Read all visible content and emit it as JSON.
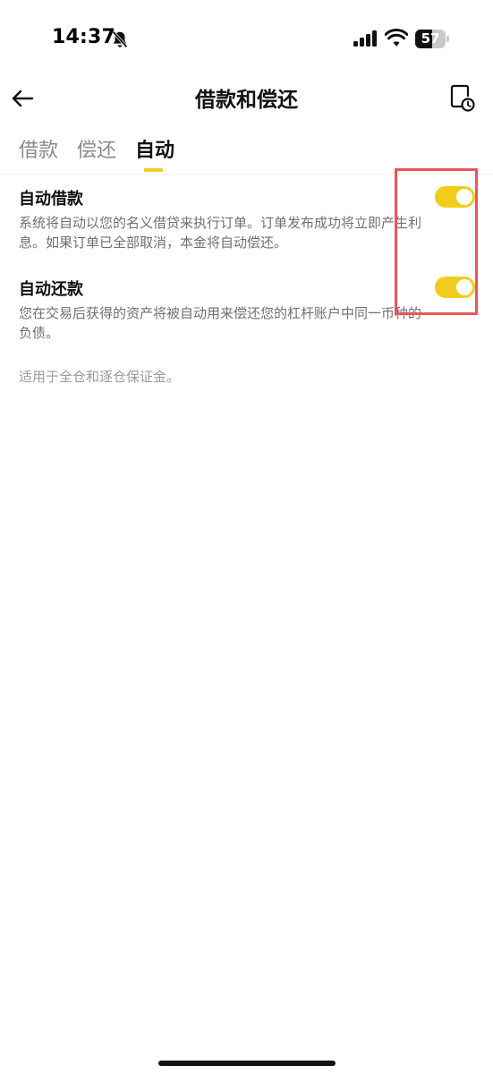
{
  "status_bar": {
    "time": "14:37",
    "battery_level": "57",
    "battery_fraction": 0.57
  },
  "header": {
    "title": "借款和偿还",
    "back_icon": "arrow-left-icon",
    "history_icon": "history-icon"
  },
  "tabs": [
    {
      "label": "借款",
      "active": false
    },
    {
      "label": "偿还",
      "active": false
    },
    {
      "label": "自动",
      "active": true
    }
  ],
  "settings": [
    {
      "title": "自动借款",
      "description": "系统将自动以您的名义借贷来执行订单。订单发布成功将立即产生利息。如果订单已全部取消，本金将自动偿还。",
      "enabled": true
    },
    {
      "title": "自动还款",
      "description": "您在交易后获得的资产将被自动用来偿还您的杠杆账户中同一币种的负债。",
      "enabled": true
    }
  ],
  "footnote": "适用于全仓和逐仓保证金。",
  "colors": {
    "accent": "#f0cd1d",
    "highlight": "#e8555c"
  }
}
